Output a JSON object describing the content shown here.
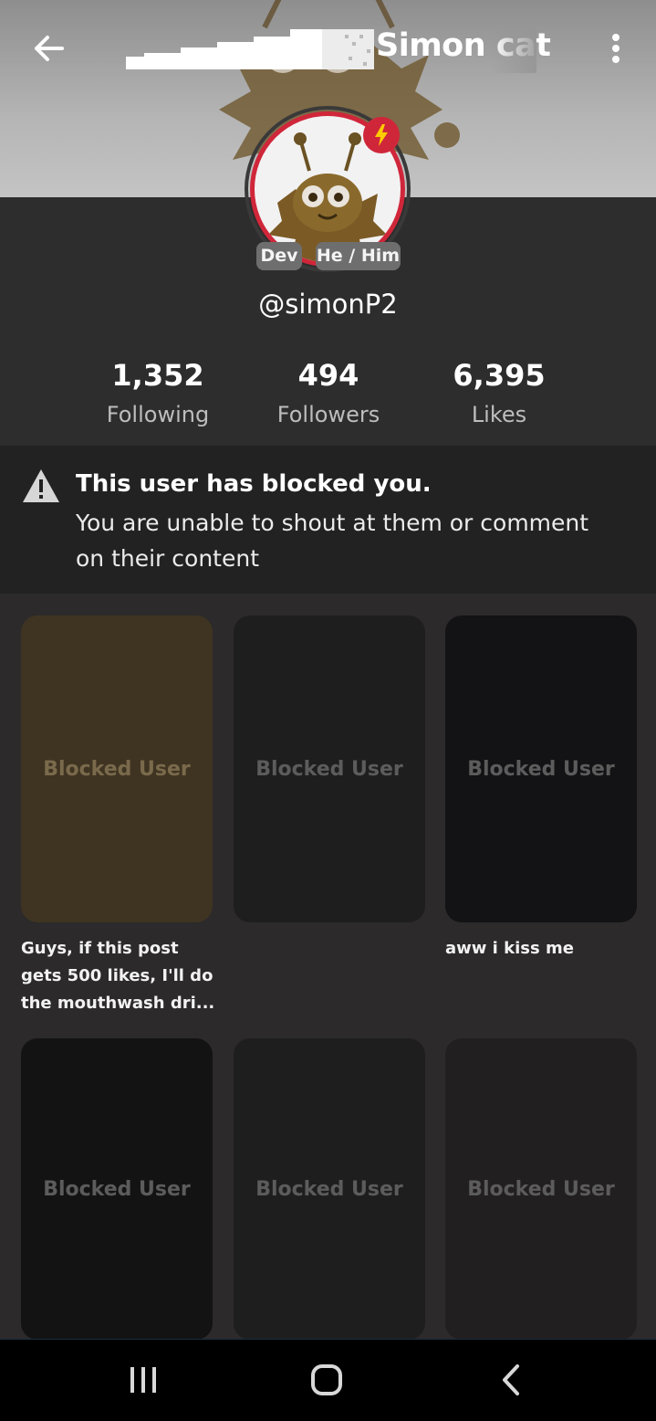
{
  "header": {
    "title": "Simon cat"
  },
  "profile": {
    "tags": [
      "Dev",
      "He / Him"
    ],
    "handle": "@simonP2",
    "stats": [
      {
        "value": "1,352",
        "label": "Following"
      },
      {
        "value": "494",
        "label": "Followers"
      },
      {
        "value": "6,395",
        "label": "Likes"
      }
    ]
  },
  "notice": {
    "title": "This user has blocked you.",
    "body": "You are unable to shout at them or comment on their content"
  },
  "posts": [
    {
      "label": "Blocked User",
      "caption": "Guys, if this post gets 500 likes, I'll do the mouthwash dri..."
    },
    {
      "label": "Blocked User",
      "caption": ""
    },
    {
      "label": "Blocked User",
      "caption": "aww i kiss me"
    },
    {
      "label": "Blocked User",
      "caption": ""
    },
    {
      "label": "Blocked User",
      "caption": ""
    },
    {
      "label": "Blocked User",
      "caption": ""
    }
  ],
  "colors": {
    "accent": "#d0263a",
    "tile_gold": "#3f3422"
  },
  "icons": [
    "back-arrow-icon",
    "more-vertical-icon",
    "lightning-icon",
    "warning-icon",
    "recent-apps-icon",
    "home-icon",
    "nav-back-icon"
  ]
}
